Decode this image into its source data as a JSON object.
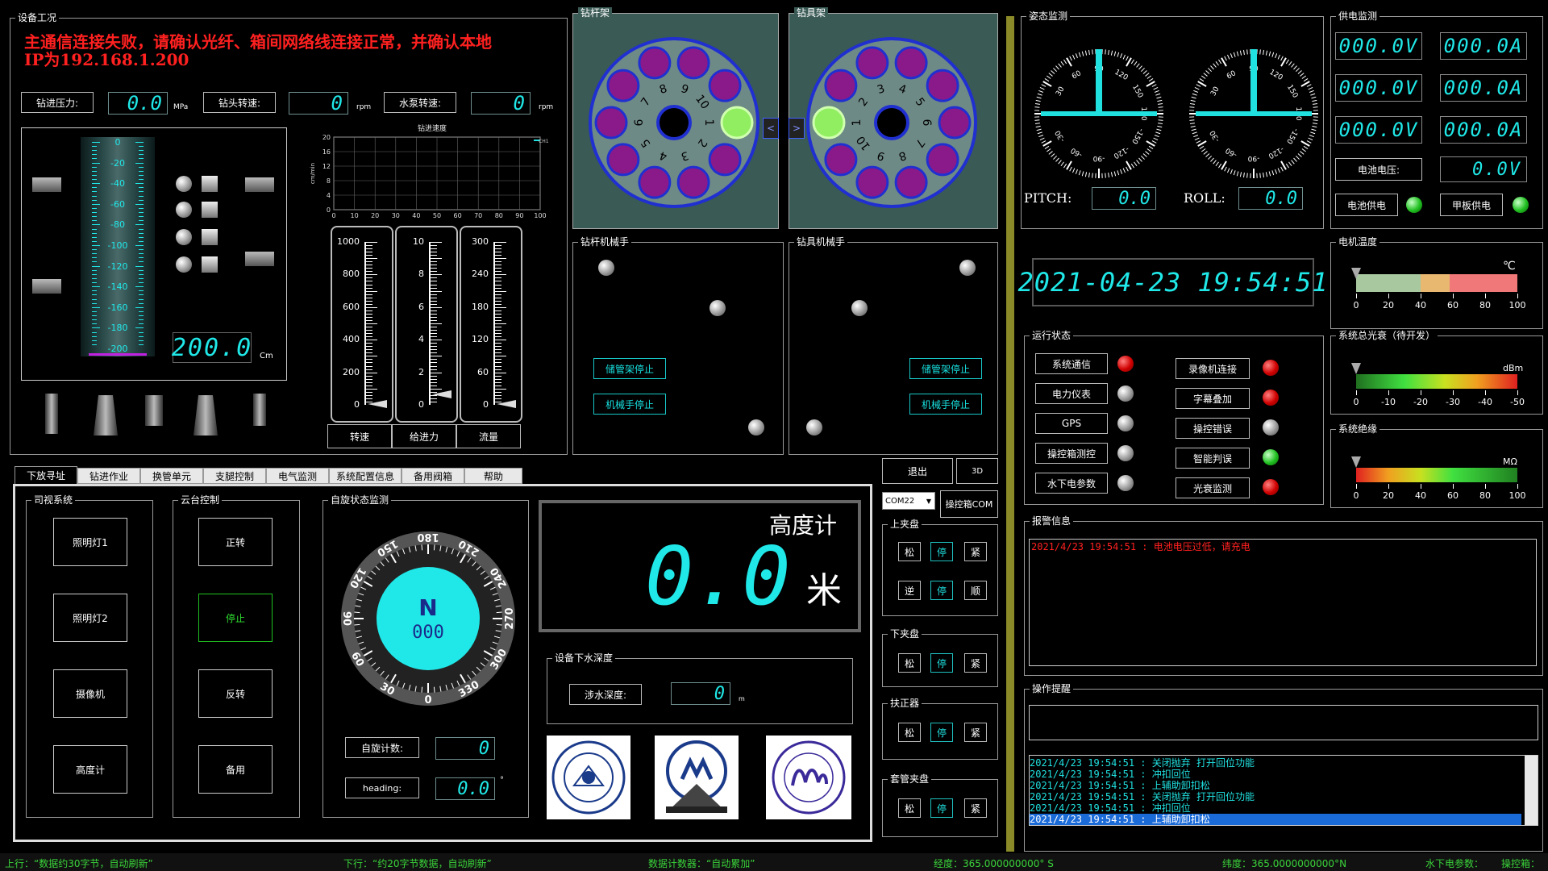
{
  "device_status": {
    "title": "设备工况",
    "alert_line1": "主通信连接失败，请确认光纤、箱间网络线连接正常，并确认本地",
    "alert_line2": "IP为192.168.1.200",
    "drill_pressure_label": "钻进压力:",
    "drill_pressure_value": "0.0",
    "drill_pressure_unit": "MPa",
    "drill_speed_label": "钻头转速:",
    "drill_speed_value": "0",
    "drill_speed_unit": "rpm",
    "pump_speed_label": "水泵转速:",
    "pump_speed_value": "0",
    "pump_speed_unit": "rpm",
    "depth_ticks": [
      "0",
      "-20",
      "-40",
      "-60",
      "-80",
      "-100",
      "-120",
      "-140",
      "-160",
      "-180",
      "-200"
    ],
    "depth_value": "200.0",
    "depth_unit": "Cm"
  },
  "speed_chart": {
    "title": "钻进速度",
    "ylabel": "cm/min",
    "legend": "CH1",
    "yticks": [
      "20",
      "16",
      "12",
      "8",
      "4",
      "0"
    ],
    "xticks": [
      "0",
      "10",
      "20",
      "30",
      "40",
      "50",
      "60",
      "70",
      "80",
      "90",
      "100"
    ]
  },
  "chart_data": {
    "type": "line",
    "title": "钻进速度",
    "xlabel": "",
    "ylabel": "cm/min",
    "xlim": [
      0,
      100
    ],
    "ylim": [
      0,
      20
    ],
    "series": [
      {
        "name": "CH1",
        "values": []
      }
    ]
  },
  "gauges": [
    {
      "ticks": [
        "1000",
        "800",
        "600",
        "400",
        "200",
        "0"
      ],
      "label": "转速",
      "level": 0
    },
    {
      "ticks": [
        "10",
        "8",
        "6",
        "4",
        "2",
        "0"
      ],
      "label": "给进力",
      "level": 0.06
    },
    {
      "ticks": [
        "300",
        "240",
        "180",
        "120",
        "60",
        "0"
      ],
      "label": "流量",
      "level": 0
    }
  ],
  "rod_rack": {
    "title": "钻杆架",
    "numbers": [
      "1",
      "2",
      "3",
      "4",
      "5",
      "6",
      "7",
      "8",
      "9",
      "10"
    ],
    "arrow": "<"
  },
  "tool_rack": {
    "title": "钻具架",
    "numbers": [
      "1",
      "2",
      "3",
      "4",
      "5",
      "6",
      "7",
      "8",
      "9",
      "10"
    ],
    "arrow": ">"
  },
  "rod_arm": {
    "title": "钻杆机械手",
    "btn1": "储管架停止",
    "btn2": "机械手停止"
  },
  "tool_arm": {
    "title": "钻具机械手",
    "btn1": "储管架停止",
    "btn2": "机械手停止"
  },
  "attitude": {
    "title": "姿态监测",
    "pitch_label": "PITCH:",
    "pitch_value": "0.0",
    "roll_label": "ROLL:",
    "roll_value": "0.0",
    "dial_ticks": [
      "90",
      "120",
      "150",
      "180",
      "-150",
      "-120",
      "-90",
      "-60",
      "-30",
      "30",
      "60"
    ],
    "datetime": "2021-04-23  19:54:51"
  },
  "power": {
    "title": "供电监测",
    "v1": "000.0V",
    "a1": "000.0A",
    "v2": "000.0V",
    "a2": "000.0A",
    "v3": "000.0V",
    "a3": "000.0A",
    "battery_label": "电池电压:",
    "battery_value": "0.0V",
    "battery_supply": "电池供电",
    "deck_supply": "甲板供电"
  },
  "motor_temp": {
    "title": "电机温度",
    "unit": "℃",
    "ticks": [
      "0",
      "20",
      "40",
      "60",
      "80",
      "100"
    ],
    "level": 0
  },
  "optical": {
    "title": "系统总光衰（待开发）",
    "unit": "dBm",
    "ticks": [
      "0",
      "-10",
      "-20",
      "-30",
      "-40",
      "-50"
    ],
    "level": 0
  },
  "insulation": {
    "title": "系统绝缘",
    "unit": "MΩ",
    "ticks": [
      "0",
      "20",
      "40",
      "60",
      "80",
      "100"
    ],
    "level": 0
  },
  "run_state": {
    "title": "运行状态",
    "left": [
      {
        "label": "系统通信",
        "led": "red"
      },
      {
        "label": "电力仪表",
        "led": "gray"
      },
      {
        "label": "GPS",
        "led": "gray"
      },
      {
        "label": "操控箱测控",
        "led": "gray"
      },
      {
        "label": "水下电参数",
        "led": "gray"
      }
    ],
    "right": [
      {
        "label": "录像机连接",
        "led": "red"
      },
      {
        "label": "字幕叠加",
        "led": "red"
      },
      {
        "label": "操控错误",
        "led": "gray"
      },
      {
        "label": "智能判误",
        "led": "green"
      },
      {
        "label": "光衰监测",
        "led": "red"
      }
    ]
  },
  "alarm": {
    "title": "报警信息",
    "messages": [
      "2021/4/23 19:54:51 : 电池电压过低，请充电"
    ]
  },
  "ops": {
    "title": "操作提醒",
    "logs": [
      "2021/4/23 19:54:51 : 关闭抛弃 打开回位功能",
      "2021/4/23 19:54:51 : 冲扣回位",
      "2021/4/23 19:54:51 : 上辅助卸扣松",
      "2021/4/23 19:54:51 : 关闭抛弃 打开回位功能",
      "2021/4/23 19:54:51 : 冲扣回位",
      "2021/4/23 19:54:51 : 上辅助卸扣松"
    ]
  },
  "tabs": [
    "下放寻址",
    "钻进作业",
    "换管单元",
    "支腿控制",
    "电气监测",
    "系统配置信息",
    "备用阀箱",
    "帮助"
  ],
  "lighting": {
    "title": "司视系统",
    "items": [
      "照明灯1",
      "照明灯2",
      "摄像机",
      "高度计"
    ]
  },
  "ptz": {
    "title": "云台控制",
    "items": [
      "正转",
      "停止",
      "反转",
      "备用"
    ]
  },
  "spin": {
    "title": "自旋状态监测",
    "compass_n": "N",
    "compass_value": "000",
    "compass_ticks": [
      "0",
      "30",
      "60",
      "90",
      "120",
      "150",
      "180",
      "210",
      "240",
      "270",
      "300",
      "330"
    ],
    "count_label": "自旋计数:",
    "count_value": "0",
    "heading_label": "heading:",
    "heading_value": "0.0",
    "heading_unit": "°"
  },
  "altimeter": {
    "title": "高度计",
    "value": "0.0",
    "unit": "米"
  },
  "depth": {
    "title": "设备下水深度",
    "label": "涉水深度:",
    "value": "0",
    "unit": "m"
  },
  "right_controls": {
    "exit": "退出",
    "btn3d": "3D",
    "com_value": "COM22",
    "com_btn": "操控箱COM",
    "upper": {
      "title": "上夹盘",
      "row1": [
        "松",
        "停",
        "紧"
      ],
      "row2": [
        "逆",
        "停",
        "顺"
      ]
    },
    "lower": {
      "title": "下夹盘",
      "row1": [
        "松",
        "停",
        "紧"
      ]
    },
    "centralizer": {
      "title": "扶正器",
      "row1": [
        "松",
        "停",
        "紧"
      ]
    },
    "casing": {
      "title": "套管夹盘",
      "row1": [
        "松",
        "停",
        "紧"
      ]
    }
  },
  "status": {
    "up": "上行：“数据约30字节，自动刷新”",
    "down": "下行：“约20字节数据，自动刷新”",
    "counter": "数据计数器：“自动累加”",
    "lon": "经度：365.000000000° S",
    "lat": "纬度：365.0000000000°N",
    "under": "水下电参数：",
    "ctrl": "操控箱："
  }
}
